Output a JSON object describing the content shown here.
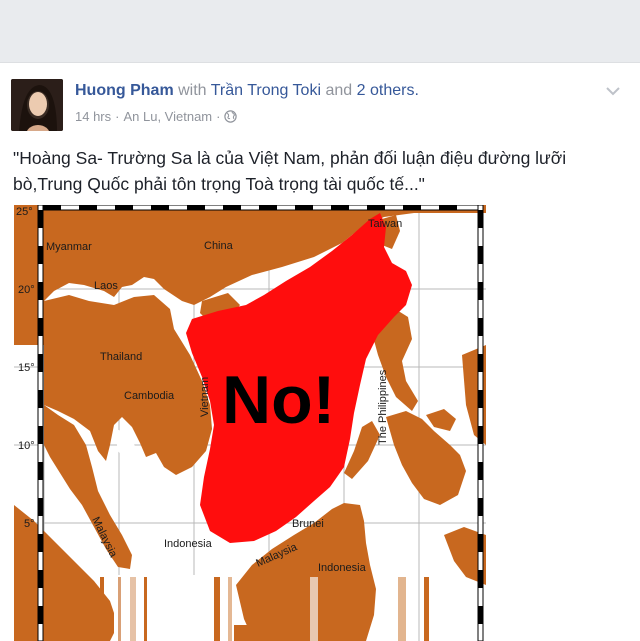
{
  "post": {
    "author": "Huong Pham",
    "with_word": "with",
    "tagged": "Trần Trong Toki",
    "and_word": "and",
    "others": "2 others.",
    "time": "14 hrs",
    "separator": "·",
    "location": "An Lu, Vietnam",
    "caption": "\"Hoàng Sa- Trường Sa là của Việt Nam, phản đối luận điệu đường lưỡi bò,Trung Quốc phải tôn trọng Toà trọng tài quốc tế...\"",
    "icons": {
      "privacy": "globe-icon",
      "menu": "chevron-down-icon"
    },
    "colors": {
      "link": "#365899",
      "land": "#c8681f",
      "claim": "#ff0d0d"
    }
  },
  "map": {
    "overlay_text": "No!",
    "lat_ticks": [
      "25°",
      "20°",
      "15°",
      "10°",
      "5°"
    ],
    "labels": {
      "taiwan": "Taiwan",
      "myanmar": "Myanmar",
      "china": "China",
      "laos": "Laos",
      "thailand": "Thailand",
      "vietnam": "Vietnam",
      "cambodia": "Cambodia",
      "philippines": "The Philippines",
      "malaysia_west": "Malaysia",
      "brunei": "Brunei",
      "indonesia_west": "Indonesia",
      "malaysia_east": "Malaysia",
      "indonesia_east": "Indonesia"
    }
  }
}
